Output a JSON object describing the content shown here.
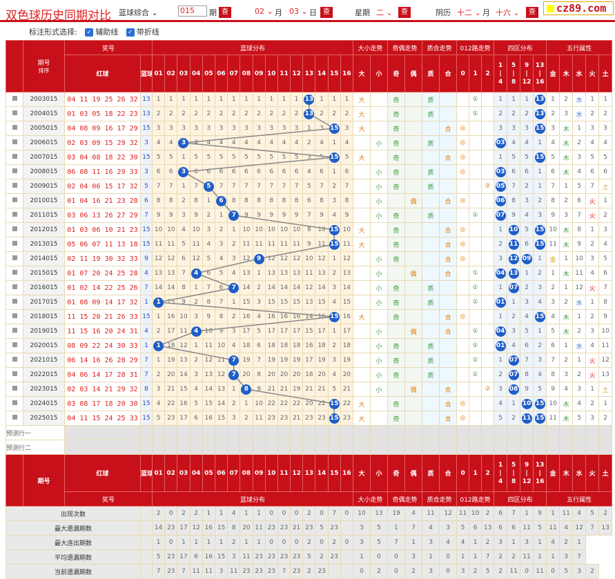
{
  "header": {
    "title": "双色球历史同期对比",
    "mode_select": "蓝球综合",
    "issue_input": "015",
    "issue_label": "期",
    "query_label": "查",
    "month_val": "02",
    "month_label": "月",
    "day_val": "03",
    "day_label": "日",
    "weekday_label": "星期",
    "weekday_val": "二",
    "lunar_label": "阴历",
    "lunar_month": "十二",
    "lunar_month_label": "月",
    "lunar_day": "十六",
    "logo": "cz89.com"
  },
  "mark_bar": {
    "label": "标注形式选择:",
    "opt1": "辅助线",
    "opt2": "带折线"
  },
  "columns": {
    "issue": "期号",
    "sort": "排序",
    "prize": "奖号",
    "red": "红球",
    "blue": "蓝球",
    "blue_dist": "蓝球分布",
    "dx": "大小走势",
    "jo": "奇偶走势",
    "zh": "质合走势",
    "lu": "012路走势",
    "sq": "四区分布",
    "wx": "五行属性",
    "nums": [
      "01",
      "02",
      "03",
      "04",
      "05",
      "06",
      "07",
      "08",
      "09",
      "10",
      "11",
      "12",
      "13",
      "14",
      "15",
      "16"
    ],
    "dx_cells": [
      "大",
      "小"
    ],
    "jo_cells": [
      "奇",
      "偶"
    ],
    "zh_cells": [
      "质",
      "合"
    ],
    "lu_cells": [
      "0",
      "1",
      "2"
    ],
    "sq_cells": [
      [
        "1",
        "|",
        "4"
      ],
      [
        "5",
        "|",
        "8"
      ],
      [
        "9",
        "|",
        "12"
      ],
      [
        "13",
        "|",
        "16"
      ]
    ],
    "wx_cells": [
      "金",
      "木",
      "水",
      "火",
      "土"
    ]
  },
  "rows": [
    {
      "issue": "2003015",
      "red": "04 11 19 25 26 32",
      "blue": 13,
      "dist": [
        1,
        1,
        1,
        1,
        1,
        1,
        1,
        1,
        1,
        1,
        1,
        1,
        0,
        1,
        1,
        1
      ],
      "dx": [
        "大",
        ""
      ],
      "jo": [
        "奇",
        ""
      ],
      "zh": [
        "质",
        ""
      ],
      "lu": [
        "",
        "①",
        ""
      ],
      "sq": [
        "1",
        "1",
        "1",
        "13"
      ],
      "wx": [
        "1",
        "2",
        "水",
        "1",
        "1"
      ]
    },
    {
      "issue": "2004015",
      "red": "01 03 05 18 22 23",
      "blue": 13,
      "dist": [
        2,
        2,
        2,
        2,
        2,
        2,
        2,
        2,
        2,
        2,
        2,
        2,
        0,
        2,
        2,
        2
      ],
      "dx": [
        "大",
        ""
      ],
      "jo": [
        "奇",
        ""
      ],
      "zh": [
        "质",
        ""
      ],
      "lu": [
        "",
        "①",
        ""
      ],
      "sq": [
        "2",
        "2",
        "2",
        "13"
      ],
      "wx": [
        "2",
        "3",
        "水",
        "2",
        "2"
      ]
    },
    {
      "issue": "2005015",
      "red": "04 08 09 16 17 29",
      "blue": 15,
      "dist": [
        3,
        3,
        3,
        3,
        3,
        3,
        3,
        3,
        3,
        3,
        3,
        3,
        1,
        3,
        0,
        3
      ],
      "dx": [
        "大",
        ""
      ],
      "jo": [
        "奇",
        ""
      ],
      "zh": [
        "",
        "合"
      ],
      "lu": [
        "◎",
        "",
        ""
      ],
      "sq": [
        "3",
        "3",
        "3",
        "15"
      ],
      "wx": [
        "3",
        "木",
        "1",
        "3",
        "3"
      ]
    },
    {
      "issue": "2006015",
      "red": "02 03 09 15 29 32",
      "blue": 3,
      "dist": [
        4,
        4,
        0,
        4,
        4,
        4,
        4,
        4,
        4,
        4,
        4,
        4,
        2,
        4,
        1,
        4
      ],
      "dx": [
        "",
        "小"
      ],
      "jo": [
        "奇",
        ""
      ],
      "zh": [
        "质",
        ""
      ],
      "lu": [
        "◎",
        "",
        ""
      ],
      "sq": [
        "03",
        "4",
        "4",
        "1"
      ],
      "wx": [
        "4",
        "木",
        "2",
        "4",
        "4"
      ]
    },
    {
      "issue": "2007015",
      "red": "03 04 08 18 22 30",
      "blue": 15,
      "dist": [
        5,
        5,
        1,
        5,
        5,
        5,
        5,
        5,
        5,
        5,
        5,
        5,
        3,
        5,
        0,
        5
      ],
      "dx": [
        "大",
        ""
      ],
      "jo": [
        "奇",
        ""
      ],
      "zh": [
        "",
        "合"
      ],
      "lu": [
        "◎",
        "",
        ""
      ],
      "sq": [
        "1",
        "5",
        "5",
        "15"
      ],
      "wx": [
        "5",
        "木",
        "3",
        "5",
        "5"
      ]
    },
    {
      "issue": "2008015",
      "red": "06 08 11 16 29 33",
      "blue": 3,
      "dist": [
        6,
        6,
        0,
        6,
        6,
        6,
        6,
        6,
        6,
        6,
        6,
        6,
        4,
        6,
        1,
        6
      ],
      "dx": [
        "",
        "小"
      ],
      "jo": [
        "奇",
        ""
      ],
      "zh": [
        "质",
        ""
      ],
      "lu": [
        "◎",
        "",
        ""
      ],
      "sq": [
        "03",
        "6",
        "6",
        "1"
      ],
      "wx": [
        "6",
        "木",
        "4",
        "6",
        "6"
      ]
    },
    {
      "issue": "2009015",
      "red": "02 04 06 15 17 32",
      "blue": 5,
      "dist": [
        7,
        7,
        1,
        7,
        0,
        7,
        7,
        7,
        7,
        7,
        7,
        7,
        5,
        7,
        2,
        7
      ],
      "dx": [
        "",
        "小"
      ],
      "jo": [
        "奇",
        ""
      ],
      "zh": [
        "质",
        ""
      ],
      "lu": [
        "",
        "",
        "②"
      ],
      "sq": [
        "05",
        "7",
        "2",
        "1"
      ],
      "wx": [
        "7",
        "1",
        "5",
        "7",
        "土"
      ]
    },
    {
      "issue": "2010015",
      "red": "01 04 16 21 23 28",
      "blue": 6,
      "dist": [
        8,
        8,
        2,
        8,
        1,
        0,
        8,
        8,
        8,
        8,
        8,
        8,
        6,
        8,
        3,
        8
      ],
      "dx": [
        "",
        "小"
      ],
      "jo": [
        "",
        "偶"
      ],
      "zh": [
        "",
        "合"
      ],
      "lu": [
        "◎",
        "",
        ""
      ],
      "sq": [
        "06",
        "8",
        "3",
        "2"
      ],
      "wx": [
        "8",
        "2",
        "6",
        "火",
        "1"
      ]
    },
    {
      "issue": "2011015",
      "red": "03 06 13 26 27 29",
      "blue": 7,
      "dist": [
        9,
        9,
        3,
        9,
        2,
        1,
        0,
        9,
        9,
        9,
        9,
        9,
        7,
        9,
        4,
        9
      ],
      "dx": [
        "",
        "小"
      ],
      "jo": [
        "奇",
        ""
      ],
      "zh": [
        "质",
        ""
      ],
      "lu": [
        "",
        "①",
        ""
      ],
      "sq": [
        "07",
        "9",
        "4",
        "3"
      ],
      "wx": [
        "9",
        "3",
        "7",
        "火",
        "2"
      ]
    },
    {
      "issue": "2012015",
      "red": "01 03 06 10 21 23",
      "blue": 15,
      "dist": [
        10,
        10,
        4,
        10,
        3,
        2,
        1,
        10,
        10,
        10,
        10,
        10,
        8,
        10,
        0,
        10
      ],
      "dx": [
        "大",
        ""
      ],
      "jo": [
        "奇",
        ""
      ],
      "zh": [
        "",
        "合"
      ],
      "lu": [
        "◎",
        "",
        ""
      ],
      "sq": [
        "1",
        "10",
        "5",
        "15"
      ],
      "wx": [
        "10",
        "木",
        "8",
        "1",
        "3"
      ]
    },
    {
      "issue": "2013015",
      "red": "05 06 07 11 13 18",
      "blue": 15,
      "dist": [
        11,
        11,
        5,
        11,
        4,
        3,
        2,
        11,
        11,
        11,
        11,
        11,
        9,
        11,
        0,
        11
      ],
      "dx": [
        "大",
        ""
      ],
      "jo": [
        "奇",
        ""
      ],
      "zh": [
        "",
        "合"
      ],
      "lu": [
        "◎",
        "",
        ""
      ],
      "sq": [
        "2",
        "11",
        "6",
        "15"
      ],
      "wx": [
        "11",
        "木",
        "9",
        "2",
        "4"
      ]
    },
    {
      "issue": "2014015",
      "red": "02 11 19 30 32 33",
      "blue": 9,
      "dist": [
        12,
        12,
        6,
        12,
        5,
        4,
        3,
        12,
        0,
        12,
        12,
        12,
        10,
        12,
        1,
        12
      ],
      "dx": [
        "",
        "小"
      ],
      "jo": [
        "奇",
        ""
      ],
      "zh": [
        "",
        "合"
      ],
      "lu": [
        "◎",
        "",
        ""
      ],
      "sq": [
        "3",
        "12",
        "09",
        "1"
      ],
      "wx": [
        "金",
        "1",
        "10",
        "3",
        "5"
      ]
    },
    {
      "issue": "2015015",
      "red": "01 07 20 24 25 28",
      "blue": 4,
      "dist": [
        13,
        13,
        7,
        0,
        6,
        5,
        4,
        13,
        1,
        13,
        13,
        13,
        11,
        13,
        2,
        13
      ],
      "dx": [
        "",
        "小"
      ],
      "jo": [
        "",
        "偶"
      ],
      "zh": [
        "",
        "合"
      ],
      "lu": [
        "",
        "①",
        ""
      ],
      "sq": [
        "04",
        "13",
        "1",
        "2"
      ],
      "wx": [
        "1",
        "木",
        "11",
        "4",
        "6"
      ]
    },
    {
      "issue": "2016015",
      "red": "01 02 14 22 25 26",
      "blue": 7,
      "dist": [
        14,
        14,
        8,
        1,
        7,
        6,
        0,
        14,
        2,
        14,
        14,
        14,
        12,
        14,
        3,
        14
      ],
      "dx": [
        "",
        "小"
      ],
      "jo": [
        "奇",
        ""
      ],
      "zh": [
        "质",
        ""
      ],
      "lu": [
        "",
        "①",
        ""
      ],
      "sq": [
        "1",
        "07",
        "2",
        "3"
      ],
      "wx": [
        "2",
        "1",
        "12",
        "火",
        "7"
      ]
    },
    {
      "issue": "2017015",
      "red": "01 08 09 14 17 32",
      "blue": 1,
      "dist": [
        0,
        15,
        9,
        2,
        8,
        7,
        1,
        15,
        3,
        15,
        15,
        15,
        13,
        15,
        4,
        15
      ],
      "dx": [
        "",
        "小"
      ],
      "jo": [
        "奇",
        ""
      ],
      "zh": [
        "质",
        ""
      ],
      "lu": [
        "",
        "①",
        ""
      ],
      "sq": [
        "01",
        "1",
        "3",
        "4"
      ],
      "wx": [
        "3",
        "2",
        "水",
        "1",
        "8"
      ]
    },
    {
      "issue": "2018015",
      "red": "11 15 20 21 26 33",
      "blue": 15,
      "dist": [
        1,
        16,
        10,
        3,
        9,
        8,
        2,
        16,
        4,
        16,
        16,
        16,
        14,
        16,
        0,
        16
      ],
      "dx": [
        "大",
        ""
      ],
      "jo": [
        "奇",
        ""
      ],
      "zh": [
        "",
        "合"
      ],
      "lu": [
        "◎",
        "",
        ""
      ],
      "sq": [
        "1",
        "2",
        "4",
        "15"
      ],
      "wx": [
        "4",
        "木",
        "1",
        "2",
        "9"
      ]
    },
    {
      "issue": "2019015",
      "red": "11 15 16 20 24 31",
      "blue": 4,
      "dist": [
        2,
        17,
        11,
        0,
        10,
        9,
        3,
        17,
        5,
        17,
        17,
        17,
        15,
        17,
        1,
        17
      ],
      "dx": [
        "",
        "小"
      ],
      "jo": [
        "",
        "偶"
      ],
      "zh": [
        "",
        "合"
      ],
      "lu": [
        "",
        "①",
        ""
      ],
      "sq": [
        "04",
        "3",
        "5",
        "1"
      ],
      "wx": [
        "5",
        "木",
        "2",
        "3",
        "10"
      ]
    },
    {
      "issue": "2020015",
      "red": "08 09 22 24 30 33",
      "blue": 1,
      "dist": [
        0,
        18,
        12,
        1,
        11,
        10,
        4,
        18,
        6,
        18,
        18,
        18,
        16,
        18,
        2,
        18
      ],
      "dx": [
        "",
        "小"
      ],
      "jo": [
        "奇",
        ""
      ],
      "zh": [
        "质",
        ""
      ],
      "lu": [
        "",
        "①",
        ""
      ],
      "sq": [
        "01",
        "4",
        "6",
        "2"
      ],
      "wx": [
        "6",
        "1",
        "水",
        "4",
        "11"
      ]
    },
    {
      "issue": "2021015",
      "red": "06 14 16 26 28 29",
      "blue": 7,
      "dist": [
        1,
        19,
        13,
        2,
        12,
        11,
        0,
        19,
        7,
        19,
        19,
        19,
        17,
        19,
        3,
        19
      ],
      "dx": [
        "",
        "小"
      ],
      "jo": [
        "奇",
        ""
      ],
      "zh": [
        "质",
        ""
      ],
      "lu": [
        "",
        "①",
        ""
      ],
      "sq": [
        "1",
        "07",
        "7",
        "3"
      ],
      "wx": [
        "7",
        "2",
        "1",
        "火",
        "12"
      ]
    },
    {
      "issue": "2022015",
      "red": "04 06 14 17 28 31",
      "blue": 7,
      "dist": [
        2,
        20,
        14,
        3,
        13,
        12,
        0,
        20,
        8,
        20,
        20,
        20,
        18,
        20,
        4,
        20
      ],
      "dx": [
        "",
        "小"
      ],
      "jo": [
        "奇",
        ""
      ],
      "zh": [
        "质",
        ""
      ],
      "lu": [
        "",
        "①",
        ""
      ],
      "sq": [
        "2",
        "07",
        "8",
        "4"
      ],
      "wx": [
        "8",
        "3",
        "2",
        "火",
        "13"
      ]
    },
    {
      "issue": "2023015",
      "red": "02 03 14 21 29 32",
      "blue": 8,
      "dist": [
        3,
        21,
        15,
        4,
        14,
        13,
        1,
        0,
        9,
        21,
        21,
        19,
        21,
        21,
        5,
        21
      ],
      "dx": [
        "",
        "小"
      ],
      "jo": [
        "",
        "偶"
      ],
      "zh": [
        "",
        "合"
      ],
      "lu": [
        "",
        "",
        "②"
      ],
      "sq": [
        "3",
        "08",
        "9",
        "5"
      ],
      "wx": [
        "9",
        "4",
        "3",
        "1",
        "土"
      ]
    },
    {
      "issue": "2024015",
      "red": "03 08 17 18 20 30",
      "blue": 15,
      "dist": [
        4,
        22,
        16,
        5,
        15,
        14,
        2,
        1,
        10,
        22,
        22,
        22,
        20,
        22,
        0,
        22
      ],
      "dx": [
        "大",
        ""
      ],
      "jo": [
        "奇",
        ""
      ],
      "zh": [
        "",
        "合"
      ],
      "lu": [
        "◎",
        "",
        ""
      ],
      "sq": [
        "4",
        "1",
        "10",
        "15"
      ],
      "wx": [
        "10",
        "木",
        "4",
        "2",
        "1"
      ]
    },
    {
      "issue": "2025015",
      "red": "04 11 15 24 25 33",
      "blue": 15,
      "dist": [
        5,
        23,
        17,
        6,
        16,
        15,
        3,
        2,
        11,
        23,
        23,
        21,
        23,
        23,
        0,
        23
      ],
      "dx": [
        "大",
        ""
      ],
      "jo": [
        "奇",
        ""
      ],
      "zh": [
        "",
        "合"
      ],
      "lu": [
        "◎",
        "",
        ""
      ],
      "sq": [
        "5",
        "2",
        "11",
        "15"
      ],
      "wx": [
        "11",
        "木",
        "5",
        "3",
        "2"
      ]
    }
  ],
  "pred": [
    "预测行一",
    "预测行二"
  ],
  "footer": {
    "rows": [
      {
        "label": "出现次数",
        "vals": [
          "2",
          "0",
          "2",
          "2",
          "1",
          "1",
          "4",
          "1",
          "1",
          "0",
          "0",
          "0",
          "2",
          "0",
          "7",
          "0",
          "10",
          "13",
          "19",
          "4",
          "11",
          "12",
          "11",
          "10",
          "2",
          "6",
          "7",
          "1",
          "9",
          "1",
          "11",
          "4",
          "5",
          "2"
        ]
      },
      {
        "label": "最大遗漏期数",
        "vals": [
          "14",
          "23",
          "17",
          "12",
          "16",
          "15",
          "8",
          "20",
          "11",
          "23",
          "23",
          "21",
          "23",
          "5",
          "23",
          "",
          "3",
          "5",
          "1",
          "7",
          "4",
          "3",
          "5",
          "6",
          "13",
          "6",
          "6",
          "11",
          "5",
          "11",
          "4",
          "12",
          "7",
          "13"
        ]
      },
      {
        "label": "最大连出期数",
        "vals": [
          "1",
          "0",
          "1",
          "1",
          "1",
          "1",
          "2",
          "1",
          "1",
          "0",
          "0",
          "0",
          "2",
          "0",
          "2",
          "0",
          "3",
          "5",
          "7",
          "1",
          "3",
          "4",
          "4",
          "1",
          "2",
          "3",
          "1",
          "3",
          "1",
          "4",
          "2",
          "1"
        ]
      },
      {
        "label": "平均遗漏期数",
        "vals": [
          "5",
          "23",
          "17",
          "6",
          "16",
          "15",
          "3",
          "11",
          "23",
          "23",
          "23",
          "23",
          "5",
          "2",
          "23",
          "",
          "1",
          "0",
          "0",
          "3",
          "1",
          "0",
          "1",
          "1",
          "7",
          "2",
          "2",
          "11",
          "1",
          "1",
          "3",
          "7"
        ]
      },
      {
        "label": "当前遗漏期数",
        "vals": [
          "7",
          "23",
          "7",
          "11",
          "11",
          "3",
          "11",
          "23",
          "23",
          "23",
          "7",
          "23",
          "2",
          "23",
          "",
          "",
          "0",
          "2",
          "0",
          "2",
          "3",
          "0",
          "3",
          "2",
          "5",
          "2",
          "11",
          "0",
          "11",
          "0",
          "5",
          "3",
          "2"
        ]
      }
    ]
  }
}
